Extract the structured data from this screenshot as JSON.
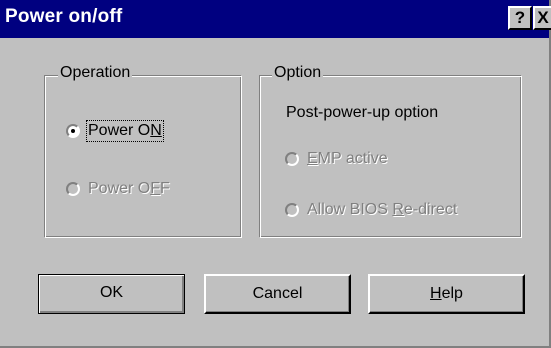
{
  "window": {
    "title": "Power on/off",
    "help_glyph": "?",
    "close_glyph": "X"
  },
  "operation_group": {
    "legend": "Operation",
    "power_on": {
      "label_pre": "Power O",
      "label_ul": "N",
      "label_post": "",
      "selected": true,
      "enabled": true
    },
    "power_off": {
      "label_pre": "Power O",
      "label_ul": "F",
      "label_post": "F",
      "selected": false,
      "enabled": false
    }
  },
  "option_group": {
    "legend": "Option",
    "post_power_up_label": "Post-power-up option",
    "emp_active": {
      "label_pre": "",
      "label_ul": "E",
      "label_post": "MP active",
      "selected": false,
      "enabled": false
    },
    "allow_bios": {
      "label_pre": "Allow BIOS ",
      "label_ul": "R",
      "label_post": "e-direct",
      "selected": false,
      "enabled": false
    }
  },
  "buttons": {
    "ok": "OK",
    "cancel": "Cancel",
    "help_pre": "",
    "help_ul": "H",
    "help_post": "elp"
  },
  "colors": {
    "titlebar": "#000080",
    "face": "#c0c0c0",
    "disabled_text": "#808080"
  }
}
